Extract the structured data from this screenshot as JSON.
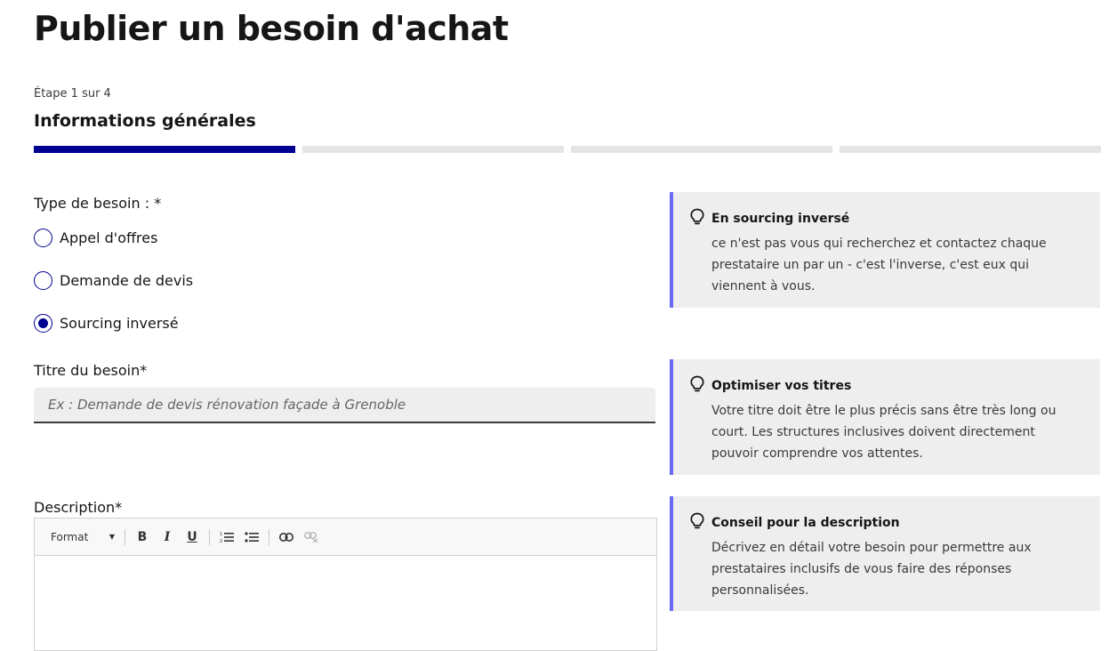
{
  "page": {
    "title": "Publier un besoin d'achat"
  },
  "stepper": {
    "step_count": "Étape 1 sur 4",
    "step_title": "Informations générales",
    "total_steps": 4,
    "current_step": 1
  },
  "form": {
    "type": {
      "label": "Type de besoin : *",
      "options": [
        {
          "label": "Appel d'offres",
          "selected": false
        },
        {
          "label": "Demande de devis",
          "selected": false
        },
        {
          "label": "Sourcing inversé",
          "selected": true
        }
      ]
    },
    "title": {
      "label": "Titre du besoin*",
      "placeholder": "Ex : Demande de devis rénovation façade à Grenoble",
      "value": ""
    },
    "description": {
      "label": "Description*",
      "toolbar": {
        "format_label": "Format",
        "buttons": [
          "bold",
          "italic",
          "underline",
          "numbered-list",
          "bulleted-list",
          "link",
          "unlink"
        ]
      }
    }
  },
  "tips": [
    {
      "title": "En sourcing inversé",
      "body": "ce n'est pas vous qui recherchez et contactez chaque prestataire un par un - c'est l'inverse, c'est eux qui viennent à vous."
    },
    {
      "title": "Optimiser vos titres",
      "body": "Votre titre doit être le plus précis sans être très long ou court. Les structures inclusives doivent directement pouvoir comprendre vos attentes."
    },
    {
      "title": "Conseil pour la description",
      "body": "Décrivez en détail votre besoin pour permettre aux prestataires inclusifs de vous faire des réponses personnalisées."
    }
  ],
  "colors": {
    "primary": "#000091",
    "tip_accent": "#6a6af4",
    "tip_bg": "#eeeeee"
  }
}
